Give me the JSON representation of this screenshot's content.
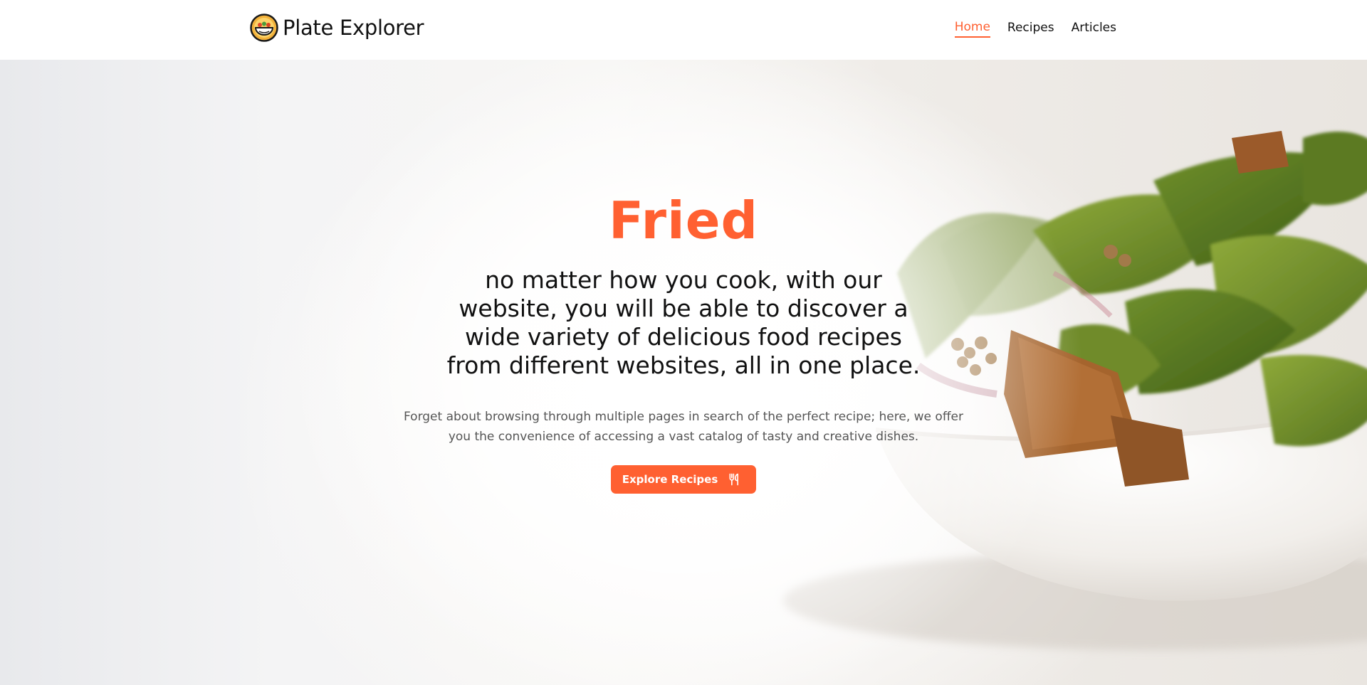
{
  "brand": {
    "name": "Plate Explorer",
    "logo_icon": "bowl-logo-icon"
  },
  "nav": {
    "items": [
      {
        "label": "Home",
        "active": true
      },
      {
        "label": "Recipes",
        "active": false
      },
      {
        "label": "Articles",
        "active": false
      }
    ]
  },
  "hero": {
    "title": "Fried",
    "subtitle": "no matter how you cook, with our website, you will be able to discover a wide variety of delicious food recipes from different websites, all in one place.",
    "description": "Forget about browsing through multiple pages in search of the perfect recipe; here, we offer you the convenience of accessing a vast catalog of tasty and creative dishes.",
    "cta_label": "Explore Recipes",
    "cta_icon": "utensils-icon",
    "background_image": "salad-bowl-photo"
  },
  "colors": {
    "accent": "#ff6031",
    "text": "#111111",
    "muted": "#555555"
  }
}
